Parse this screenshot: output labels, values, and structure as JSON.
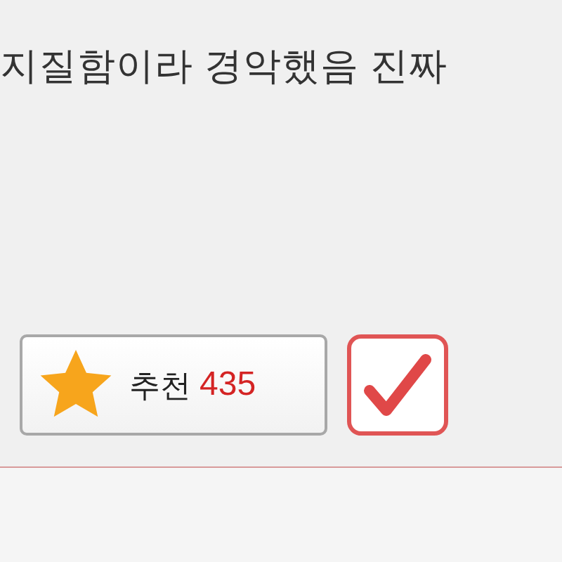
{
  "post": {
    "text_line": "지질함이라 경악했음 진짜"
  },
  "recommend_button": {
    "label": "추천",
    "count": "435"
  },
  "check_button": {
    "checked": true
  }
}
